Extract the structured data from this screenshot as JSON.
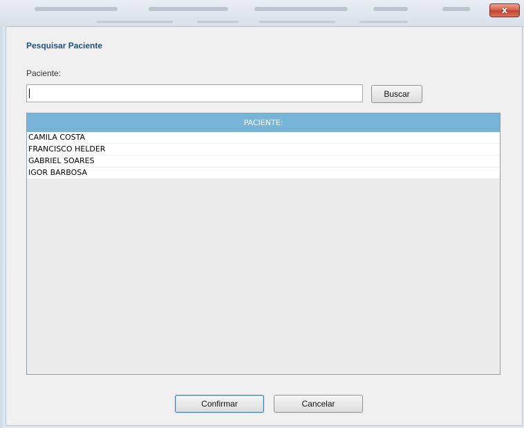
{
  "window": {
    "close_glyph": "x",
    "title": "Pesquisar Paciente"
  },
  "search": {
    "label": "Paciente:",
    "value": "",
    "button_label": "Buscar"
  },
  "table": {
    "header": "PACIENTE:",
    "rows": [
      "CAMILA COSTA",
      "FRANCISCO HELDER",
      "GABRIEL SOARES",
      "IGOR BARBOSA"
    ]
  },
  "actions": {
    "confirm_label": "Confirmar",
    "cancel_label": "Cancelar"
  },
  "colors": {
    "title": "#1f4f82",
    "table_header_bg": "#78b4d8",
    "close_button": "#c24530"
  }
}
